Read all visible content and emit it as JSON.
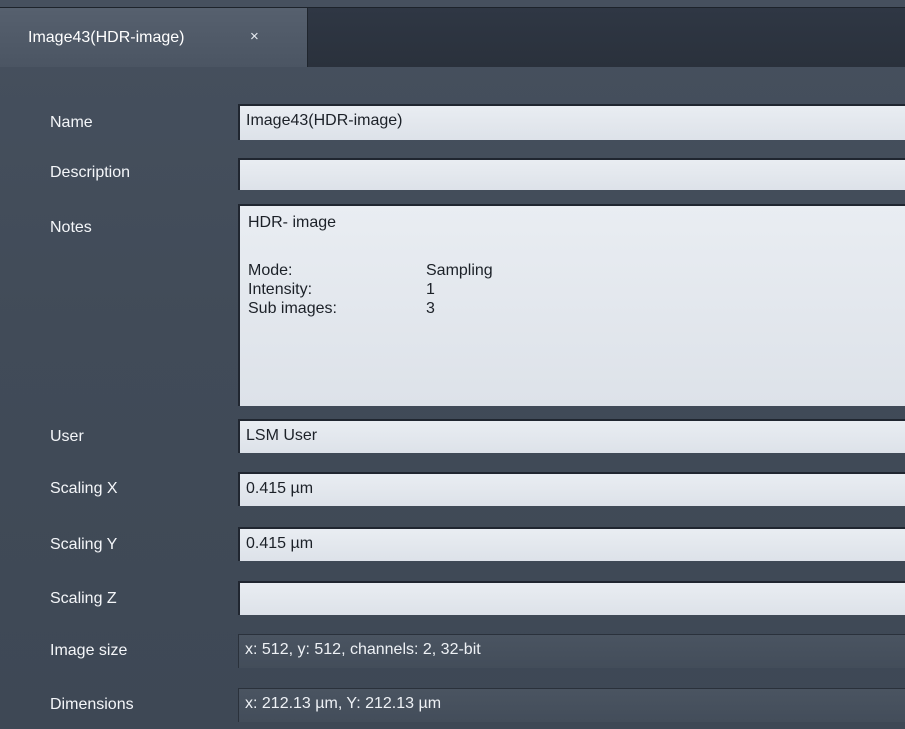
{
  "tab": {
    "title": "Image43(HDR-image)",
    "close_glyph": "×"
  },
  "fields": {
    "name": {
      "label": "Name",
      "value": "Image43(HDR-image)"
    },
    "description": {
      "label": "Description",
      "value": ""
    },
    "notes": {
      "label": "Notes",
      "heading": "HDR- image",
      "rows": [
        {
          "key": "Mode:",
          "value": "Sampling"
        },
        {
          "key": "Intensity:",
          "value": "1"
        },
        {
          "key": "Sub images:",
          "value": "3"
        }
      ]
    },
    "user": {
      "label": "User",
      "value": "LSM User"
    },
    "scaling_x": {
      "label": "Scaling X",
      "value": "0.415 µm"
    },
    "scaling_y": {
      "label": "Scaling Y",
      "value": "0.415 µm"
    },
    "scaling_z": {
      "label": "Scaling Z",
      "value": ""
    },
    "image_size": {
      "label": "Image size",
      "value": "x: 512, y: 512, channels: 2, 32-bit"
    },
    "dimensions": {
      "label": "Dimensions",
      "value": "x: 212.13 µm, Y: 212.13 µm"
    }
  },
  "colors": {
    "panel_background": "#434d5a",
    "editable_field": "#e3e7ed",
    "readonly_field": "#47515e",
    "tab_active": "#515b69"
  }
}
